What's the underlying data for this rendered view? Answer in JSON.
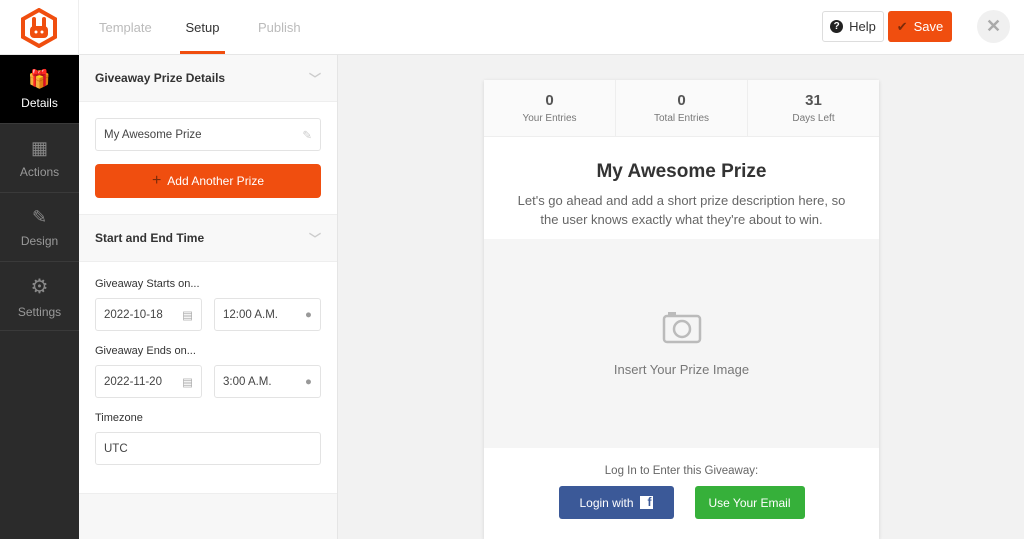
{
  "header": {
    "tabs": [
      {
        "label": "Template"
      },
      {
        "label": "Setup"
      },
      {
        "label": "Publish"
      }
    ],
    "help_label": "Help",
    "save_label": "Save"
  },
  "sidebar": {
    "items": [
      {
        "label": "Details",
        "icon": "gift-icon"
      },
      {
        "label": "Actions",
        "icon": "cubes-icon"
      },
      {
        "label": "Design",
        "icon": "pencil-ruler-icon"
      },
      {
        "label": "Settings",
        "icon": "gear-icon"
      }
    ]
  },
  "panel": {
    "prize_section": {
      "title": "Giveaway Prize Details",
      "prize_name": "My Awesome Prize",
      "add_label": "Add Another Prize"
    },
    "time_section": {
      "title": "Start and End Time",
      "starts_label": "Giveaway Starts on...",
      "start_date": "2022-10-18",
      "start_time": "12:00 A.M.",
      "ends_label": "Giveaway Ends on...",
      "end_date": "2022-11-20",
      "end_time": "3:00 A.M.",
      "timezone_label": "Timezone",
      "timezone": "UTC"
    }
  },
  "preview": {
    "stats": [
      {
        "value": "0",
        "label": "Your Entries"
      },
      {
        "value": "0",
        "label": "Total Entries"
      },
      {
        "value": "31",
        "label": "Days Left"
      }
    ],
    "title": "My Awesome Prize",
    "description": "Let's go ahead and add a short prize description here, so the user knows exactly what they're about to win.",
    "image_placeholder": "Insert Your Prize Image",
    "login_prompt": "Log In to Enter this Giveaway:",
    "facebook_label": "Login with",
    "email_label": "Use Your Email"
  },
  "colors": {
    "accent": "#f04e0f",
    "facebook": "#3b5998",
    "email": "#36b03a",
    "sidebar": "#2b2b2b"
  }
}
